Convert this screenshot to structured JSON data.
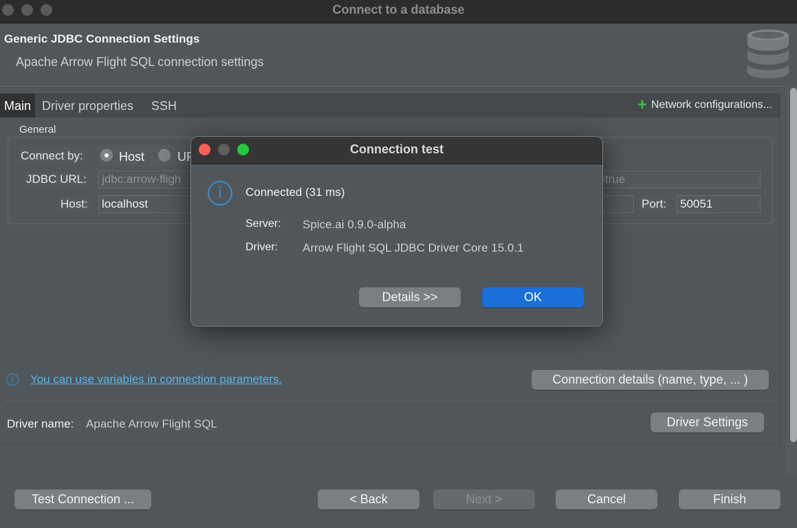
{
  "window": {
    "title": "Connect to a database"
  },
  "header": {
    "title": "Generic JDBC Connection Settings",
    "subtitle": "Apache Arrow Flight SQL connection settings",
    "icon": "database-icon"
  },
  "tabs": [
    {
      "label": "Main",
      "active": true
    },
    {
      "label": "Driver properties",
      "active": false
    },
    {
      "label": "SSH",
      "active": false
    }
  ],
  "network_config": {
    "icon": "plus-icon",
    "label": "Network configurations..."
  },
  "general": {
    "section_label": "General",
    "connect_by_label": "Connect by:",
    "connect_by_options": [
      {
        "label": "Host",
        "checked": true
      },
      {
        "label": "URL",
        "checked": false
      }
    ],
    "jdbc_url_label": "JDBC URL:",
    "jdbc_url_value_start": "jdbc:arrow-fligh",
    "jdbc_url_value_end": "=true",
    "host_label": "Host:",
    "host_value": "localhost",
    "port_label": "Port:",
    "port_value": "50051"
  },
  "variables_link": "You can use variables in connection parameters.",
  "connection_details_button": "Connection details (name, type, ... )",
  "driver": {
    "label": "Driver name:",
    "value": "Apache Arrow Flight SQL",
    "settings_button": "Driver Settings"
  },
  "footer": {
    "test_connection": "Test Connection ...",
    "back": "< Back",
    "next": "Next >",
    "cancel": "Cancel",
    "finish": "Finish"
  },
  "dialog": {
    "title": "Connection test",
    "status": "Connected (31 ms)",
    "server_label": "Server:",
    "server_value": "Spice.ai 0.9.0-alpha",
    "driver_label": "Driver:",
    "driver_value": "Arrow Flight SQL JDBC Driver Core 15.0.1",
    "details_button": "Details >>",
    "ok_button": "OK"
  },
  "colors": {
    "accent": "#1a6fd8",
    "link": "#5cb4e6",
    "info": "#3a8fd0",
    "close": "#fe5f57",
    "zoom": "#28c840",
    "plus": "#3fbf3f"
  }
}
